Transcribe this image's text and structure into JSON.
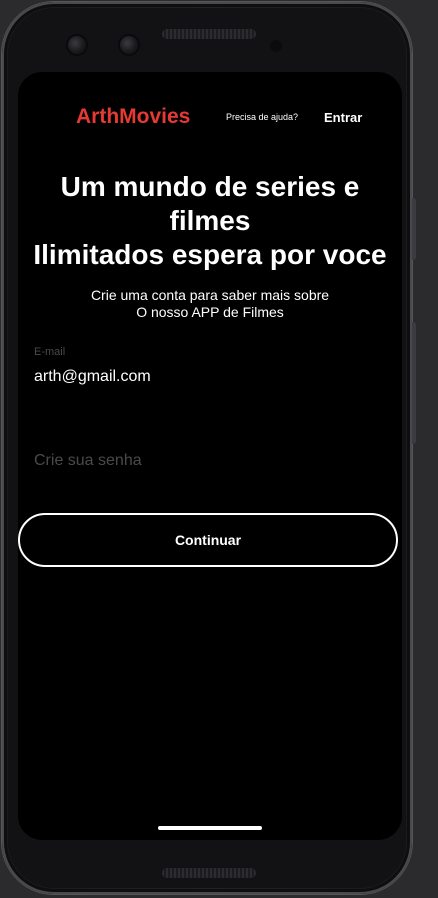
{
  "header": {
    "brand": "ArthMovies",
    "help_link": "Precisa de ajuda?",
    "login_button": "Entrar"
  },
  "hero": {
    "title_lines": [
      "Um mundo de series e",
      "filmes",
      "Ilimitados espera por voce"
    ],
    "subtitle_lines": [
      "Crie uma conta para saber mais sobre",
      "O nosso APP de Filmes"
    ]
  },
  "form": {
    "email_label": "E-mail",
    "email_value": "arth@gmail.com",
    "password_placeholder": "Crie sua senha",
    "continue_label": "Continuar"
  },
  "colors": {
    "brand": "#e53935",
    "background": "#000000",
    "text": "#ffffff",
    "muted": "#4a4a4a"
  }
}
